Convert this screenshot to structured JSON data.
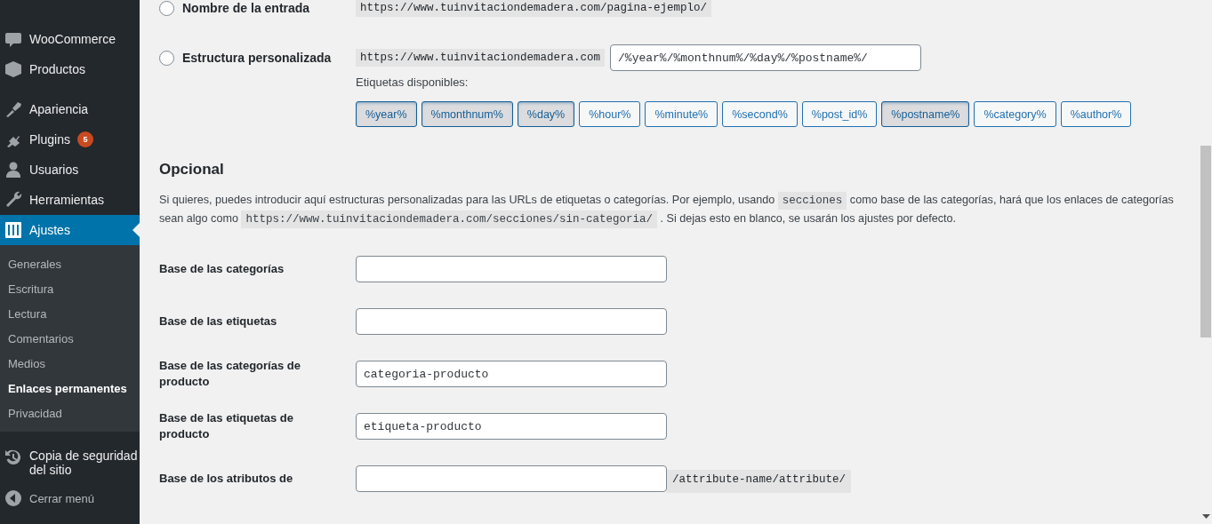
{
  "sidebar": {
    "menu": [
      {
        "label": "WooCommerce",
        "selected": false
      },
      {
        "label": "Productos",
        "selected": false
      },
      {
        "label": "Apariencia",
        "selected": false
      },
      {
        "label": "Plugins",
        "badge": "5",
        "selected": false
      },
      {
        "label": "Usuarios",
        "selected": false
      },
      {
        "label": "Herramientas",
        "selected": false
      },
      {
        "label": "Ajustes",
        "selected": true
      }
    ],
    "submenu": [
      {
        "label": "Generales",
        "selected": false
      },
      {
        "label": "Escritura",
        "selected": false
      },
      {
        "label": "Lectura",
        "selected": false
      },
      {
        "label": "Comentarios",
        "selected": false
      },
      {
        "label": "Medios",
        "selected": false
      },
      {
        "label": "Enlaces permanentes",
        "selected": true
      },
      {
        "label": "Privacidad",
        "selected": false
      }
    ],
    "footer": [
      {
        "label": "Copia de seguridad del sitio"
      },
      {
        "label": "Cerrar menú"
      }
    ]
  },
  "permalink_options": [
    {
      "label": "Nombre de la entrada",
      "selected": false,
      "example": "https://www.tuinvitaciondemadera.com/pagina-ejemplo/"
    },
    {
      "label": "Estructura personalizada",
      "selected": false,
      "example": "https://www.tuinvitaciondemadera.com",
      "value": "/%year%/%monthnum%/%day%/%postname%/"
    }
  ],
  "tags_label": "Etiquetas disponibles:",
  "tags": [
    {
      "label": "%year%",
      "selected": true
    },
    {
      "label": "%monthnum%",
      "selected": true
    },
    {
      "label": "%day%",
      "selected": true
    },
    {
      "label": "%hour%",
      "selected": false
    },
    {
      "label": "%minute%",
      "selected": false
    },
    {
      "label": "%second%",
      "selected": false
    },
    {
      "label": "%post_id%",
      "selected": false
    },
    {
      "label": "%postname%",
      "selected": true
    },
    {
      "label": "%category%",
      "selected": false
    },
    {
      "label": "%author%",
      "selected": false
    }
  ],
  "optional": {
    "heading": "Opcional",
    "description": [
      {
        "kind": "text",
        "text": "Si quieres, puedes introducir aquí estructuras personalizadas para las URLs de etiquetas o categorías. Por ejemplo, usando "
      },
      {
        "kind": "code",
        "text": "secciones"
      },
      {
        "kind": "text",
        "text": " como base de las categorías, hará que los enlaces de categorías sean algo como "
      },
      {
        "kind": "code",
        "text": "https://www.tuinvitaciondemadera.com/secciones/sin-categoria/"
      },
      {
        "kind": "text",
        "text": " . Si dejas esto en blanco, se usarán los ajustes por defecto."
      }
    ],
    "fields": [
      {
        "label": "Base de las categorías"
      },
      {
        "label": "Base de las etiquetas"
      },
      {
        "label": "Base de las categorías de producto",
        "value": "categoria-producto"
      },
      {
        "label": "Base de las etiquetas de producto",
        "value": "etiqueta-producto"
      },
      {
        "label": "Base de los atributos de",
        "suffix": "/attribute-name/attribute/"
      }
    ]
  }
}
